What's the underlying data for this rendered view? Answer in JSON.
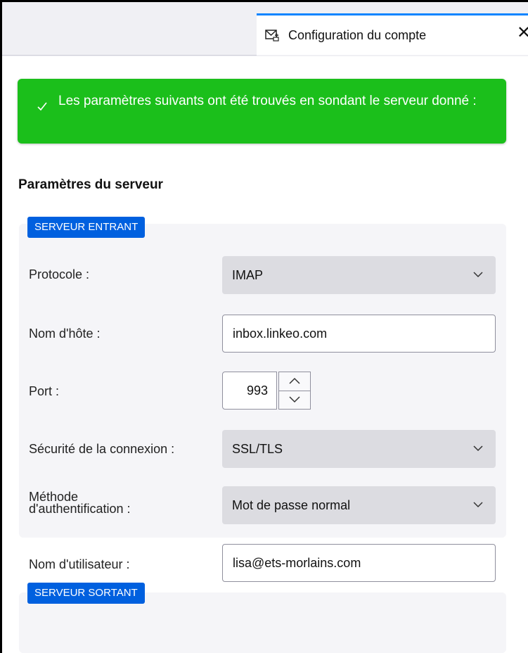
{
  "tab": {
    "title": "Configuration du compte",
    "icon": "mail-settings-icon",
    "close_label": "✕"
  },
  "notification": {
    "message": "Les paramètres suivants ont été trouvés en sondant le serveur donné :",
    "color": "#1bbf1b",
    "icon": "check-icon"
  },
  "server_settings": {
    "title": "Paramètres du serveur",
    "incoming": {
      "badge": "SERVEUR ENTRANT",
      "protocol": {
        "label": "Protocole :",
        "value": "IMAP"
      },
      "hostname": {
        "label": "Nom d'hôte :",
        "value": "inbox.linkeo.com"
      },
      "port": {
        "label": "Port :",
        "value": "993"
      },
      "security": {
        "label": "Sécurité de la connexion :",
        "value": "SSL/TLS"
      },
      "auth": {
        "label_line1": "Méthode",
        "label_line2": "d'authentification :",
        "value": "Mot de passe normal"
      },
      "username": {
        "label": "Nom d'utilisateur :",
        "value": "lisa@ets-morlains.com"
      }
    },
    "outgoing": {
      "badge": "SERVEUR SORTANT"
    }
  },
  "colors": {
    "accent": "#0060df",
    "tab_highlight": "#0a84ff"
  }
}
